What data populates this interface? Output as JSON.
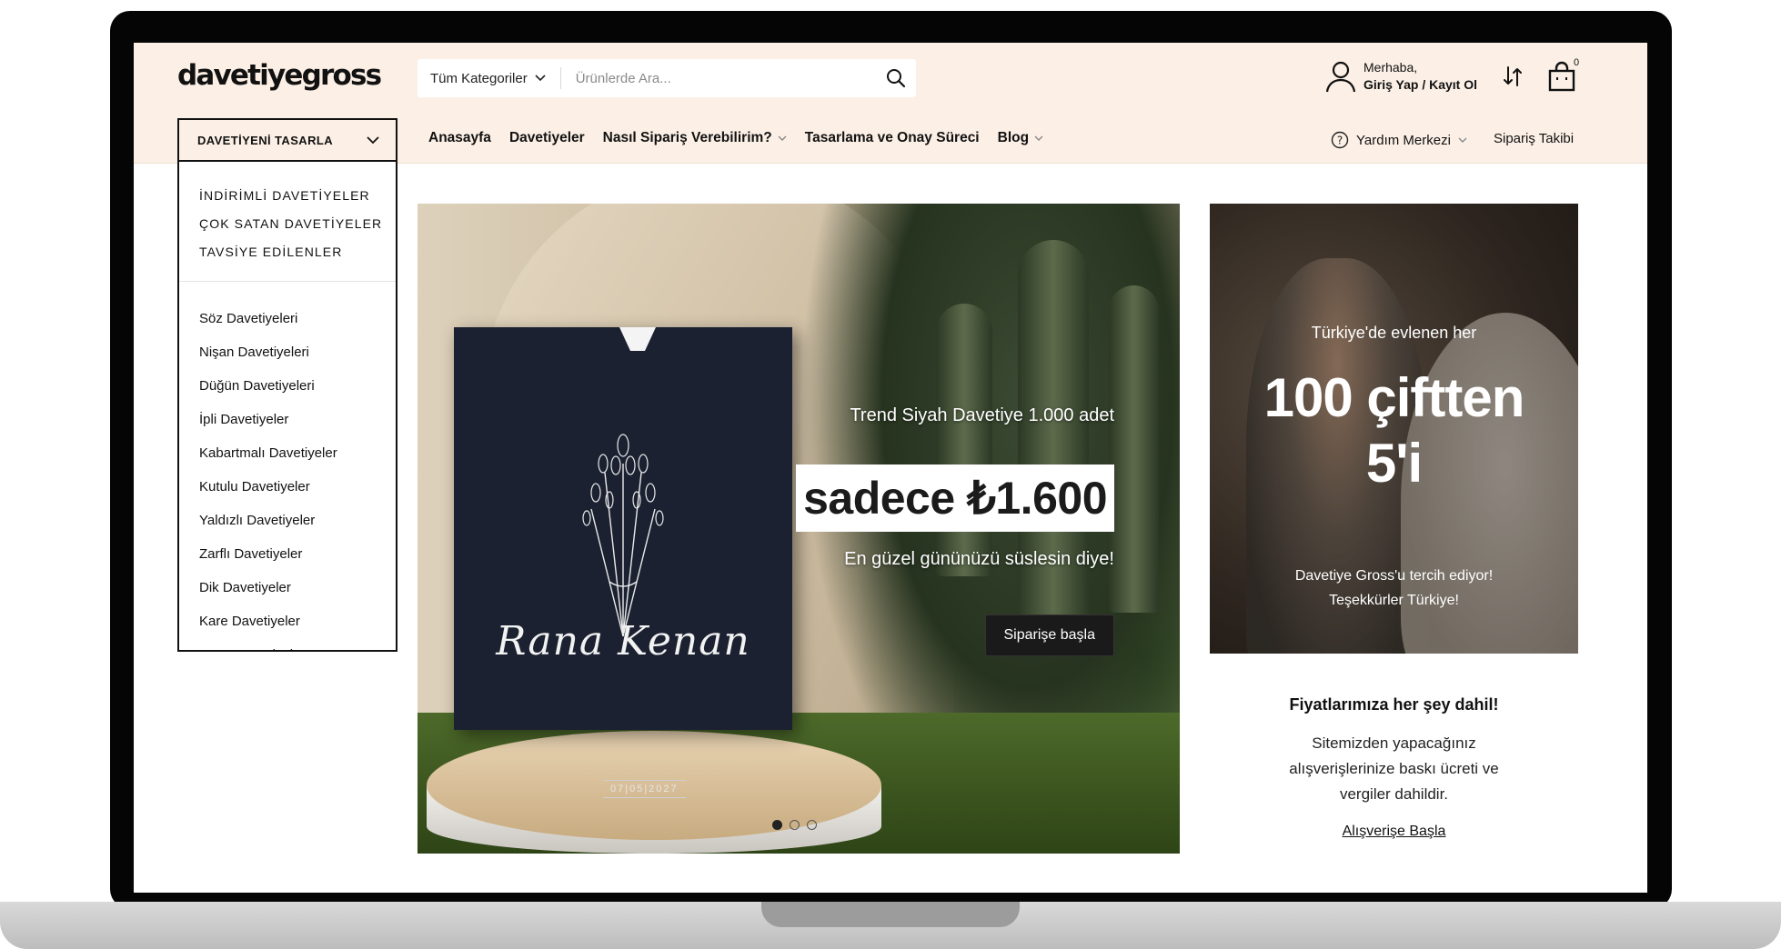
{
  "brand": {
    "logo": "davetiyegross"
  },
  "search": {
    "category": "Tüm Kategoriler",
    "placeholder": "Ürünlerde Ara..."
  },
  "account": {
    "greeting": "Merhaba,",
    "action": "Giriş Yap / Kayıt Ol"
  },
  "cart": {
    "count": "0"
  },
  "design_button": "DAVETİYENİ TASARLA",
  "nav": [
    {
      "label": "Anasayfa",
      "has_dropdown": false
    },
    {
      "label": "Davetiyeler",
      "has_dropdown": false
    },
    {
      "label": "Nasıl Sipariş Verebilirim?",
      "has_dropdown": true
    },
    {
      "label": "Tasarlama ve Onay Süreci",
      "has_dropdown": false
    },
    {
      "label": "Blog",
      "has_dropdown": true
    }
  ],
  "help": {
    "label": "Yardım Merkezi"
  },
  "order_tracking": "Sipariş Takibi",
  "dropdown": {
    "featured": [
      "İNDİRİMLİ DAVETİYELER",
      "ÇOK SATAN DAVETİYELER",
      "TAVSİYE EDİLENLER"
    ],
    "categories": [
      "Söz Davetiyeleri",
      "Nişan Davetiyeleri",
      "Düğün Davetiyeleri",
      "İpli Davetiyeler",
      "Kabartmalı Davetiyeler",
      "Kutulu Davetiyeler",
      "Yaldızlı Davetiyeler",
      "Zarflı Davetiyeler",
      "Dik Davetiyeler",
      "Kare Davetiyeler",
      "Yatay Davetiyeler"
    ]
  },
  "hero": {
    "subtitle": "Trend Siyah Davetiye 1.000 adet",
    "price": "sadece ₺1.600",
    "tagline": "En güzel gününüzü süslesin diye!",
    "button": "Siparişe başla",
    "card_names": "Rana   Kenan",
    "card_date": "07|05|2027",
    "slides_total": 3,
    "slide_active": 1
  },
  "promo": {
    "line1": "Türkiye'de evlenen her",
    "big1": "100 çiftten",
    "big2": "5'i",
    "bottom1": "Davetiye Gross'u tercih ediyor!",
    "bottom2": "Teşekkürler Türkiye!"
  },
  "info": {
    "title": "Fiyatlarımıza her şey dahil!",
    "text": "Sitemizden yapacağınız alışverişlerinize baskı ücreti ve vergiler dahildir.",
    "link": "Alışverişe Başla"
  }
}
